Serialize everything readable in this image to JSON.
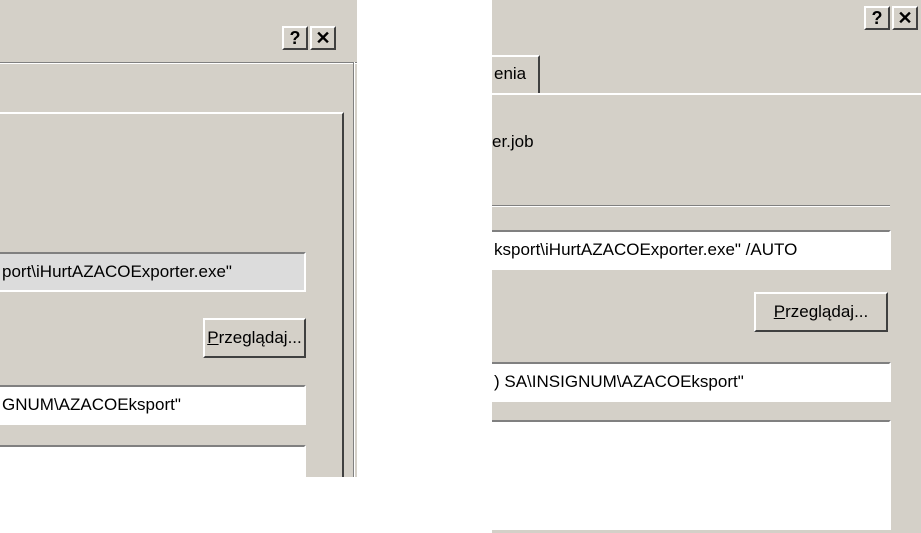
{
  "left_dialog": {
    "help_icon": "?",
    "close_icon": "✕",
    "command_field": {
      "value": "port\\iHurtAZACOExporter.exe\""
    },
    "browse_button": {
      "mnemonic": "P",
      "label_rest": "rzeglądaj..."
    },
    "start_in_field": {
      "value": "GNUM\\AZACOEksport\""
    }
  },
  "right_dialog": {
    "help_icon": "?",
    "close_icon": "✕",
    "tab_label": "enia",
    "file_name": "er.job",
    "command_field": {
      "value": "ksport\\iHurtAZACOExporter.exe\" /AUTO"
    },
    "browse_button": {
      "mnemonic": "P",
      "label_rest": "rzeglądaj..."
    },
    "start_in_field": {
      "value": ") SA\\INSIGNUM\\AZACOEksport\""
    }
  },
  "colors": {
    "dialog_face": "#d4d0c8",
    "field_bg": "#ffffff",
    "shadow": "#404040"
  }
}
